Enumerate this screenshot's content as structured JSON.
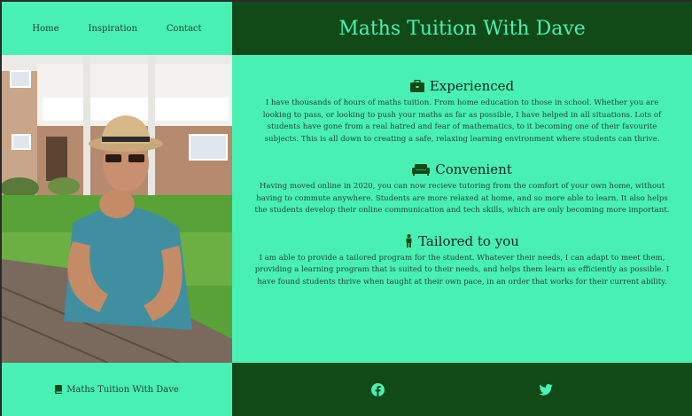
{
  "nav": {
    "items": [
      "Home",
      "Inspiration",
      "Contact"
    ]
  },
  "header": {
    "title": "Maths Tuition With Dave"
  },
  "sections": [
    {
      "icon": "briefcase-icon",
      "title": "Experienced",
      "text": "I have thousands of hours of maths tuition. From home education to those in school. Whether you are looking to pass, or looking to push your maths as far as possible, I have helped in all situations. Lots of students have gone from a real hatred and fear of mathematics, to it becoming one of their favourite subjects. This is all down to creating a safe, relaxing learning environment where students can thrive."
    },
    {
      "icon": "couch-icon",
      "title": "Convenient",
      "text": "Having moved online in 2020, you can now recieve tutoring from the comfort of your own home, without having to commute anywhere. Students are more relaxed at home, and so more able to learn. It also helps the students develop their online communication and tech skills, which are only becoming more important."
    },
    {
      "icon": "person-icon",
      "title": "Tailored to you",
      "text": "I am able to provide a tailored program for the student. Whatever their needs, I can adapt to meet them, providing a learning program that is suited to their needs, and helps them learn as efficiently as possible. I have found students thrive when taught at their own pace, in an order that works for their current ability."
    }
  ],
  "footer": {
    "brand": "Maths Tuition With Dave",
    "brand_icon": "book-icon",
    "social": [
      "facebook-icon",
      "twitter-icon"
    ]
  },
  "colors": {
    "mint": "#48f1b3",
    "dark_green": "#124a17",
    "text": "#16241f"
  }
}
